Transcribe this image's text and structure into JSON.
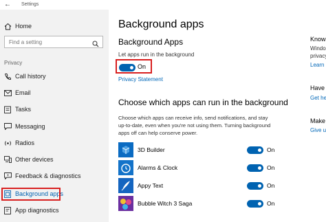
{
  "titlebar": {
    "title": "Settings"
  },
  "sidebar": {
    "home_label": "Home",
    "search_placeholder": "Find a setting",
    "section": "Privacy",
    "items": [
      {
        "label": "Call history",
        "icon": "call-history-icon"
      },
      {
        "label": "Email",
        "icon": "email-icon"
      },
      {
        "label": "Tasks",
        "icon": "tasks-icon"
      },
      {
        "label": "Messaging",
        "icon": "messaging-icon"
      },
      {
        "label": "Radios",
        "icon": "radios-icon"
      },
      {
        "label": "Other devices",
        "icon": "other-devices-icon"
      },
      {
        "label": "Feedback & diagnostics",
        "icon": "feedback-icon"
      },
      {
        "label": "Background apps",
        "icon": "background-apps-icon",
        "selected": true
      },
      {
        "label": "App diagnostics",
        "icon": "app-diagnostics-icon"
      }
    ]
  },
  "main": {
    "title": "Background apps",
    "subtitle": "Background Apps",
    "toggle_caption": "Let apps run in the background",
    "master_toggle_state": "On",
    "privacy_link": "Privacy Statement",
    "choose_heading": "Choose which apps can run in the background",
    "description": "Choose which apps can receive info, send notifications, and stay up-to-date, even when you're not using them. Turning background apps off can help conserve power.",
    "apps": [
      {
        "name": "3D Builder",
        "state": "On",
        "icon": "3d-builder-icon"
      },
      {
        "name": "Alarms & Clock",
        "state": "On",
        "icon": "alarms-clock-icon"
      },
      {
        "name": "Appy Text",
        "state": "On",
        "icon": "appy-text-icon"
      },
      {
        "name": "Bubble Witch 3 Saga",
        "state": "On",
        "icon": "bubble-witch-icon"
      }
    ]
  },
  "right_panel": {
    "line1": "Know y",
    "line2": "Windo",
    "line3": "privacy",
    "link1": "Learn m",
    "heading2": "Have a",
    "link2": "Get he",
    "heading3": "Make W",
    "link3": "Give us"
  },
  "colors": {
    "accent": "#0063b1",
    "link": "#0067b8",
    "highlight": "#d81e1e"
  }
}
